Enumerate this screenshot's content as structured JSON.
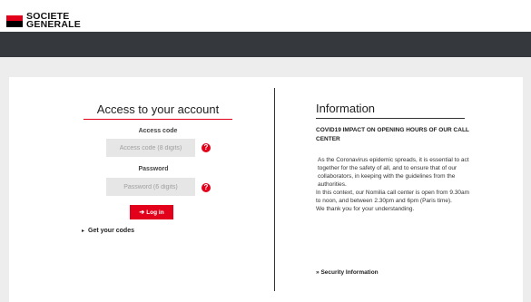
{
  "brand": {
    "name_line1": "SOCIETE",
    "name_line2": "GENERALE",
    "accent_color": "#e2001a"
  },
  "login": {
    "title": "Access to your account",
    "access_code_label": "Access code",
    "access_code_placeholder": "Access code (8 digits)",
    "access_code_value": "",
    "password_label": "Password",
    "password_placeholder": "Password (6 digits)",
    "password_value": "",
    "help_icon": "question-mark-icon",
    "help_glyph": "?",
    "login_button_label": "Log in",
    "login_icon": "sign-in-icon",
    "login_icon_glyph": "➔",
    "get_codes_label": "Get your codes",
    "get_codes_glyph": "▸"
  },
  "info": {
    "title": "Information",
    "heading": "COVID19 IMPACT ON OPENING HOURS OF OUR CALL CENTER",
    "paragraphs": [
      "As the Coronavirus epidemic spreads, it is essential to act together for the safety of all, and to ensure that of our collaborators, in keeping with the guidelines from the authorities.",
      "In this context, our Nomilia call center is open from 9.30am to noon, and between 2.30pm and 6pm (Paris time).",
      "We thank you for your understanding."
    ],
    "security_link_prefix": "»",
    "security_link_label": "Security Information"
  }
}
